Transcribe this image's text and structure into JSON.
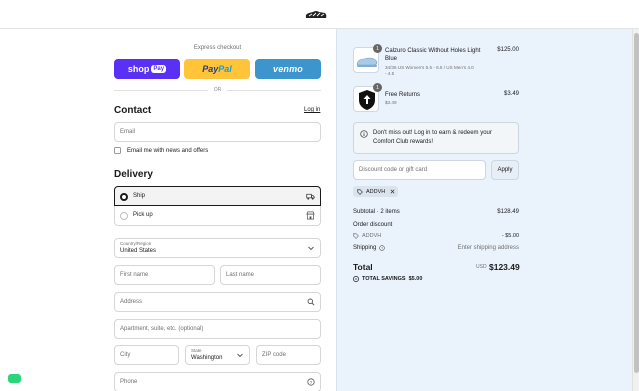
{
  "header": {
    "logo_icon": "brand-logo-icon"
  },
  "express": {
    "title": "Express checkout",
    "shoppay_label": "shop",
    "shoppay_badge": "Pay",
    "paypal_pay": "Pay",
    "paypal_pal": "Pal",
    "venmo_label": "venmo",
    "or_label": "OR"
  },
  "contact": {
    "title": "Contact",
    "login_label": "Log in",
    "email_placeholder": "Email",
    "newsletter_label": "Email me with news and offers"
  },
  "delivery": {
    "title": "Delivery",
    "options": [
      {
        "label": "Ship",
        "selected": true,
        "icon": "truck-icon"
      },
      {
        "label": "Pick up",
        "selected": false,
        "icon": "store-icon"
      }
    ],
    "country_label": "Country/Region",
    "country_value": "United States",
    "first_name_placeholder": "First name",
    "last_name_placeholder": "Last name",
    "address_placeholder": "Address",
    "apartment_placeholder": "Apartment, suite, etc. (optional)",
    "city_placeholder": "City",
    "state_label": "State",
    "state_value": "Washington",
    "zip_placeholder": "ZIP code",
    "phone_placeholder": "Phone"
  },
  "cart": {
    "items": [
      {
        "title_line1": "Calzuro Classic Without Holes Light",
        "title_line2": "Blue",
        "sub_line1": "34/35 US Women's 5.5 - 6.5 / US Men's 4.0",
        "sub_line2": "- 4.5",
        "price": "$125.00",
        "qty": "1"
      },
      {
        "title_line1": "Free Returns",
        "sub_line1": "$3.49",
        "price": "$3.49",
        "qty": "1"
      }
    ]
  },
  "notice": {
    "text": "Don't miss out! Log in to earn & redeem your Comfort Club rewards!"
  },
  "discount": {
    "placeholder": "Discount code or gift card",
    "apply_label": "Apply",
    "applied_code": "ADDVH"
  },
  "summary": {
    "subtotal_label": "Subtotal · 2 items",
    "subtotal_value": "$128.49",
    "order_discount_label": "Order discount",
    "discount_code": "ADDVH",
    "discount_value": "- $5.00",
    "shipping_label": "Shipping",
    "shipping_value": "Enter shipping address",
    "total_label": "Total",
    "currency": "USD",
    "total_value": "$123.49",
    "savings_label": "TOTAL SAVINGS",
    "savings_value": "$5.00"
  },
  "colors": {
    "shoppay": "#5a31f4",
    "paypal": "#ffc439",
    "venmo": "#3d95ce",
    "summary_bg": "#eaf3fc",
    "chat_widget": "#2bd67b"
  }
}
